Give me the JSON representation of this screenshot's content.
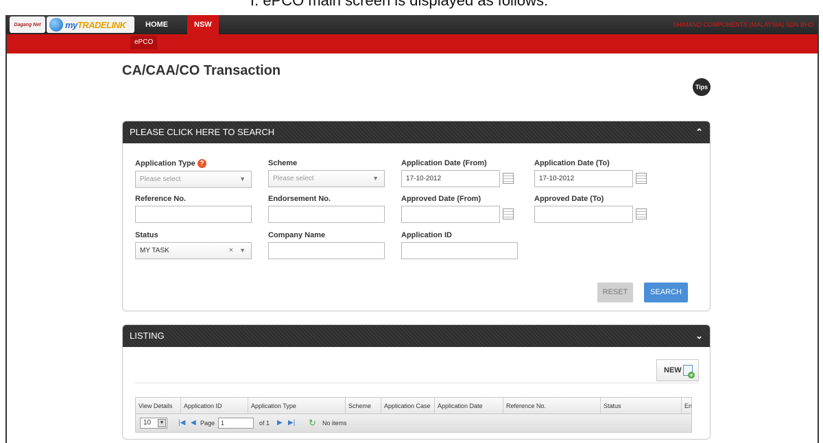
{
  "caption": "f.  ePCO main screen is displayed as follows:",
  "header": {
    "logo1_text": "Dagang Net",
    "logo2_text_my": "my",
    "logo2_text_brand": "TRADELINK",
    "nav": [
      {
        "label": "HOME"
      },
      {
        "label": "NSW"
      }
    ],
    "user_company": "SHIMANO COMPONENTS (MALAYSIA) SDN BHD",
    "subnav": [
      {
        "label": "ePCO"
      }
    ]
  },
  "page": {
    "title": "CA/CAA/CO Transaction",
    "tips_label": "Tips"
  },
  "search_panel": {
    "header": "PLEASE CLICK HERE TO SEARCH",
    "fields": {
      "application_type": {
        "label": "Application Type",
        "value": "Please select"
      },
      "scheme": {
        "label": "Scheme",
        "value": "Please select"
      },
      "app_date_from": {
        "label": "Application Date (From)",
        "value": "17-10-2012"
      },
      "app_date_to": {
        "label": "Application Date (To)",
        "value": "17-10-2012"
      },
      "reference_no": {
        "label": "Reference No.",
        "value": ""
      },
      "endorsement_no": {
        "label": "Endorsement No.",
        "value": ""
      },
      "approved_from": {
        "label": "Approved Date (From)",
        "value": ""
      },
      "approved_to": {
        "label": "Approved Date (To)",
        "value": ""
      },
      "status": {
        "label": "Status",
        "value": "MY TASK"
      },
      "company_name": {
        "label": "Company Name",
        "value": ""
      },
      "application_id": {
        "label": "Application ID",
        "value": ""
      }
    },
    "reset_label": "RESET",
    "search_label": "SEARCH"
  },
  "listing_panel": {
    "header": "LISTING",
    "new_label": "NEW",
    "columns": [
      "View Details",
      "Application ID",
      "Application Type",
      "Scheme",
      "Application Case",
      "Application Date",
      "Reference No.",
      "Status",
      "En"
    ],
    "pager": {
      "page_size": "10",
      "page_label": "Page",
      "page_value": "1",
      "of_label": "of 1",
      "no_items": "No items"
    }
  }
}
